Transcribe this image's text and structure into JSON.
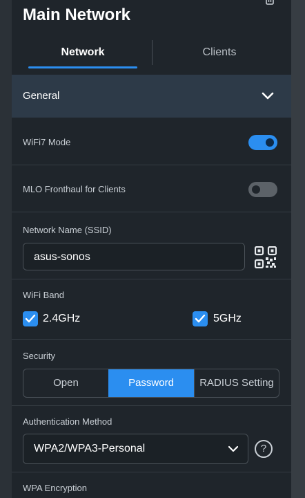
{
  "header": {
    "title": "Main Network"
  },
  "tabs": [
    {
      "label": "Network",
      "active": true
    },
    {
      "label": "Clients",
      "active": false
    }
  ],
  "section": {
    "label": "General",
    "expanded": true
  },
  "wifi7": {
    "label": "WiFi7 Mode",
    "enabled": true
  },
  "mlo": {
    "label": "MLO Fronthaul for Clients",
    "enabled": false
  },
  "ssid": {
    "label": "Network Name (SSID)",
    "value": "asus-sonos"
  },
  "band": {
    "label": "WiFi Band",
    "options": [
      {
        "label": "2.4GHz",
        "checked": true
      },
      {
        "label": "5GHz",
        "checked": true
      }
    ]
  },
  "security": {
    "label": "Security",
    "options": [
      "Open",
      "Password",
      "RADIUS Setting"
    ],
    "selected": "Password"
  },
  "auth": {
    "label": "Authentication Method",
    "value": "WPA2/WPA3-Personal",
    "help_glyph": "?"
  },
  "encryption": {
    "label": "WPA Encryption"
  },
  "colors": {
    "accent": "#2b8ef0",
    "panel": "#1f252b",
    "section_header": "#2d3a48"
  }
}
